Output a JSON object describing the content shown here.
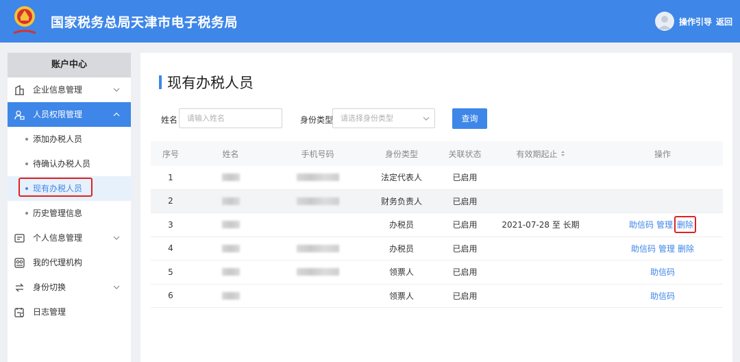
{
  "header": {
    "title": "国家税务总局天津市电子税务局",
    "guide_label": "操作引导",
    "back_label": "返回"
  },
  "sidebar": {
    "title": "账户中心",
    "items": [
      {
        "label": "企业信息管理",
        "icon": "building-icon"
      },
      {
        "label": "人员权限管理",
        "icon": "user-lock-icon"
      },
      {
        "label": "个人信息管理",
        "icon": "id-card-icon"
      },
      {
        "label": "我的代理机构",
        "icon": "agency-icon"
      },
      {
        "label": "身份切换",
        "icon": "switch-icon"
      },
      {
        "label": "日志管理",
        "icon": "log-icon"
      }
    ],
    "sub_items": [
      {
        "label": "添加办税人员"
      },
      {
        "label": "待确认办税人员"
      },
      {
        "label": "现有办税人员"
      },
      {
        "label": "历史管理信息"
      }
    ]
  },
  "main": {
    "title": "现有办税人员",
    "filters": {
      "name_label": "姓名",
      "name_placeholder": "请输入姓名",
      "type_label": "身份类型",
      "type_placeholder": "请选择身份类型",
      "query_label": "查询"
    },
    "table": {
      "headers": [
        "序号",
        "姓名",
        "手机号码",
        "身份类型",
        "关联状态",
        "有效期起止",
        "操作"
      ],
      "rows": [
        {
          "no": "1",
          "type": "法定代表人",
          "status": "已启用",
          "period": "",
          "ops": []
        },
        {
          "no": "2",
          "type": "财务负责人",
          "status": "已启用",
          "period": "",
          "ops": []
        },
        {
          "no": "3",
          "type": "办税员",
          "status": "已启用",
          "period": "2021-07-28 至 长期",
          "ops": [
            "助信码",
            "管理",
            "删除"
          ]
        },
        {
          "no": "4",
          "type": "办税员",
          "status": "已启用",
          "period": "",
          "ops": [
            "助信码",
            "管理",
            "删除"
          ]
        },
        {
          "no": "5",
          "type": "领票人",
          "status": "已启用",
          "period": "",
          "ops": [
            "助信码"
          ]
        },
        {
          "no": "6",
          "type": "领票人",
          "status": "已启用",
          "period": "",
          "ops": [
            "助信码"
          ]
        }
      ]
    }
  },
  "colors": {
    "brand": "#3e86e8",
    "highlight": "#e02020"
  }
}
